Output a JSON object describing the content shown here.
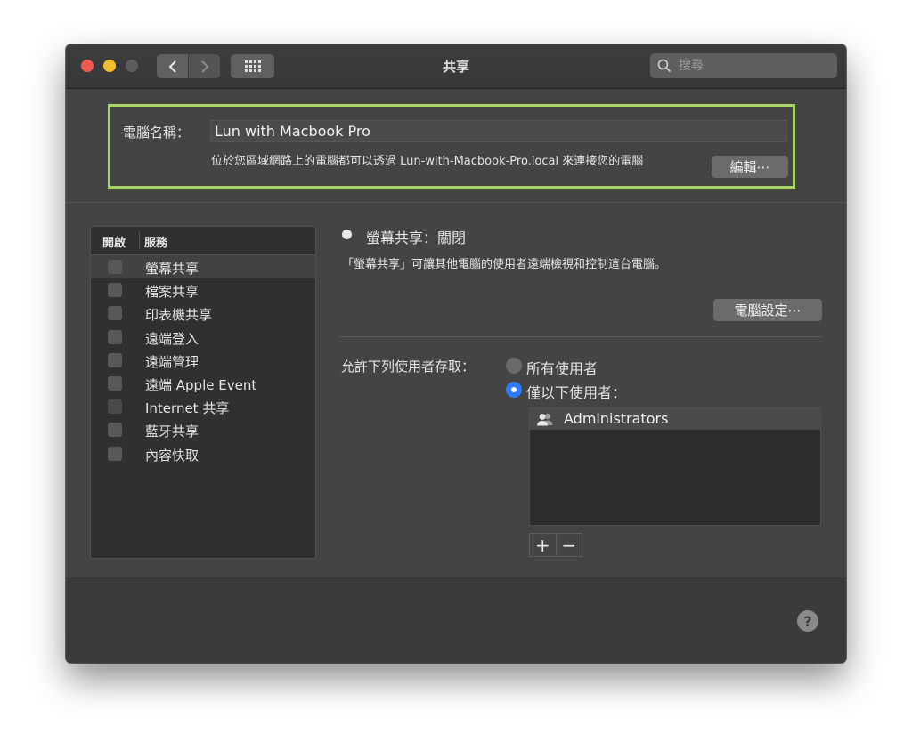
{
  "window": {
    "title": "共享"
  },
  "search": {
    "placeholder": "搜尋"
  },
  "computer_name": {
    "label": "電腦名稱：",
    "value": "Lun with Macbook Pro",
    "description": "位於您區域網路上的電腦都可以透過 Lun-with-Macbook-Pro.local 來連接您的電腦",
    "edit_label": "編輯⋯"
  },
  "services": {
    "header_on": "開啟",
    "header_service": "服務",
    "items": [
      {
        "label": "螢幕共享"
      },
      {
        "label": "檔案共享"
      },
      {
        "label": "印表機共享"
      },
      {
        "label": "遠端登入"
      },
      {
        "label": "遠端管理"
      },
      {
        "label": "遠端 Apple Event"
      },
      {
        "label": "Internet 共享"
      },
      {
        "label": "藍牙共享"
      },
      {
        "label": "內容快取"
      }
    ]
  },
  "detail": {
    "status": "螢幕共享：關閉",
    "description": "「螢幕共享」可讓其他電腦的使用者遠端檢視和控制這台電腦。",
    "computer_settings_label": "電腦設定⋯",
    "allow_label": "允許下列使用者存取：",
    "radio_all": "所有使用者",
    "radio_only": "僅以下使用者：",
    "users": [
      {
        "name": "Administrators"
      }
    ],
    "add_label": "+",
    "remove_label": "−"
  },
  "help": {
    "label": "?"
  },
  "icons": {
    "back": "chevron-left-icon",
    "forward": "chevron-right-icon",
    "grid": "grid-icon",
    "search": "search-icon",
    "user_group": "user-group-icon",
    "help": "help-icon"
  },
  "colors": {
    "highlight_border": "#a6d565",
    "radio_selected": "#2f7bf5",
    "close": "#ee5a52",
    "minimize": "#f4bd2f"
  }
}
